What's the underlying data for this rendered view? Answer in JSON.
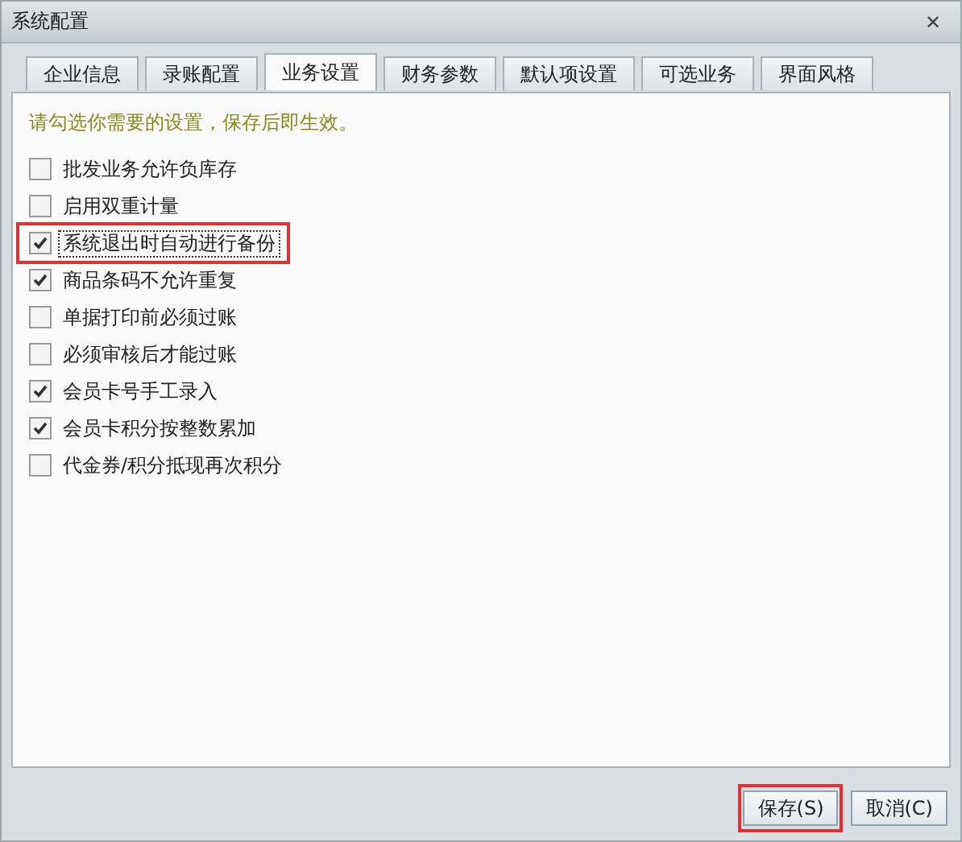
{
  "window": {
    "title": "系统配置",
    "close": "✕"
  },
  "tabs": [
    {
      "label": "企业信息",
      "selected": false
    },
    {
      "label": "录账配置",
      "selected": false
    },
    {
      "label": "业务设置",
      "selected": true
    },
    {
      "label": "财务参数",
      "selected": false
    },
    {
      "label": "默认项设置",
      "selected": false
    },
    {
      "label": "可选业务",
      "selected": false
    },
    {
      "label": "界面风格",
      "selected": false
    }
  ],
  "hint": "请勾选你需要的设置，保存后即生效。",
  "options": [
    {
      "label": "批发业务允许负库存",
      "checked": false,
      "focused": false,
      "highlighted": false
    },
    {
      "label": "启用双重计量",
      "checked": false,
      "focused": false,
      "highlighted": false
    },
    {
      "label": "系统退出时自动进行备份",
      "checked": true,
      "focused": true,
      "highlighted": true
    },
    {
      "label": "商品条码不允许重复",
      "checked": true,
      "focused": false,
      "highlighted": false
    },
    {
      "label": "单据打印前必须过账",
      "checked": false,
      "focused": false,
      "highlighted": false
    },
    {
      "label": "必须审核后才能过账",
      "checked": false,
      "focused": false,
      "highlighted": false
    },
    {
      "label": "会员卡号手工录入",
      "checked": true,
      "focused": false,
      "highlighted": false
    },
    {
      "label": "会员卡积分按整数累加",
      "checked": true,
      "focused": false,
      "highlighted": false
    },
    {
      "label": "代金券/积分抵现再次积分",
      "checked": false,
      "focused": false,
      "highlighted": false
    }
  ],
  "buttons": [
    {
      "label": "保存(S)",
      "highlighted": true
    },
    {
      "label": "取消(C)",
      "highlighted": false
    }
  ]
}
